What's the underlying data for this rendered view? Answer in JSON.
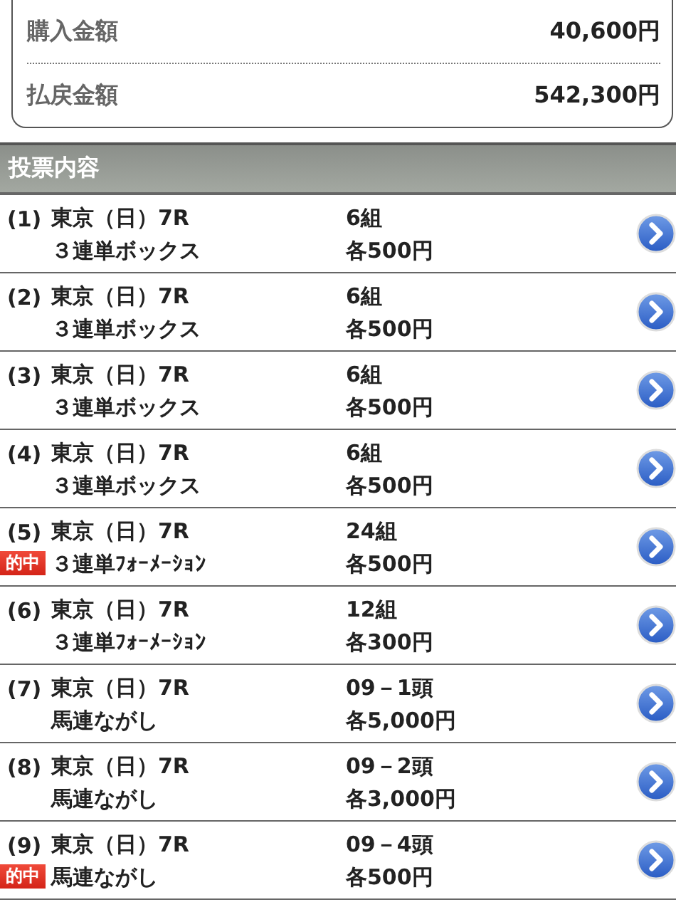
{
  "summary": [
    {
      "label": "購入金額",
      "value": "40,600円"
    },
    {
      "label": "払戻金額",
      "value": "542,300円"
    }
  ],
  "section_title": "投票内容",
  "bets": [
    {
      "number": "(1)",
      "race": "東京（日）7R",
      "type": "３連単ボックス",
      "count": "6組",
      "amount": "各500円"
    },
    {
      "number": "(2)",
      "race": "東京（日）7R",
      "type": "３連単ボックス",
      "count": "6組",
      "amount": "各500円"
    },
    {
      "number": "(3)",
      "race": "東京（日）7R",
      "type": "３連単ボックス",
      "count": "6組",
      "amount": "各500円"
    },
    {
      "number": "(4)",
      "race": "東京（日）7R",
      "type": "３連単ボックス",
      "count": "6組",
      "amount": "各500円"
    },
    {
      "number": "(5)",
      "badge": "的中",
      "race": "東京（日）7R",
      "type": "３連単ﾌｫｰﾒｰｼｮﾝ",
      "count": "24組",
      "amount": "各500円"
    },
    {
      "number": "(6)",
      "race": "東京（日）7R",
      "type": "３連単ﾌｫｰﾒｰｼｮﾝ",
      "count": "12組",
      "amount": "各300円"
    },
    {
      "number": "(7)",
      "race": "東京（日）7R",
      "type": "馬連ながし",
      "count": "09－1頭",
      "amount": "各5,000円"
    },
    {
      "number": "(8)",
      "race": "東京（日）7R",
      "type": "馬連ながし",
      "count": "09－2頭",
      "amount": "各3,000円"
    },
    {
      "number": "(9)",
      "badge": "的中",
      "race": "東京（日）7R",
      "type": "馬連ながし",
      "count": "09－4頭",
      "amount": "各500円"
    }
  ]
}
